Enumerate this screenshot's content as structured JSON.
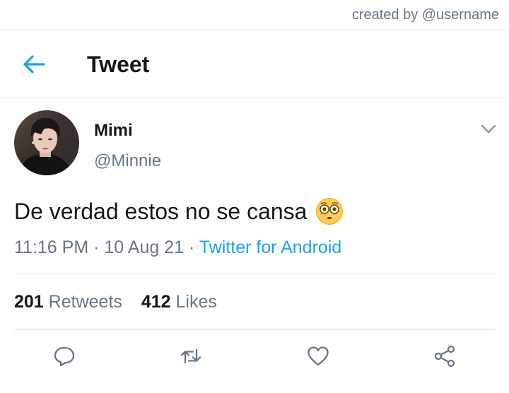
{
  "watermark": "created by @username",
  "header": {
    "back_icon": "arrow-left-icon",
    "title": "Tweet"
  },
  "tweet": {
    "author": {
      "display_name": "Mimi",
      "handle": "@Minnie",
      "avatar": "profile-photo"
    },
    "menu_icon": "chevron-down-icon",
    "text": "De verdad estos no se cansa",
    "emoji": "flushed-face-emoji",
    "time": "11:16 PM",
    "separator": "·",
    "date": "10 Aug 21",
    "source": "Twitter for Android"
  },
  "stats": {
    "retweets_count": "201",
    "retweets_label": "Retweets",
    "likes_count": "412",
    "likes_label": "Likes"
  },
  "actions": [
    "reply-icon",
    "retweet-icon",
    "like-icon",
    "share-icon"
  ],
  "colors": {
    "accent": "#1da1f2",
    "text_primary": "#14171a",
    "text_secondary": "#657786",
    "divider": "#e1e8ed"
  }
}
